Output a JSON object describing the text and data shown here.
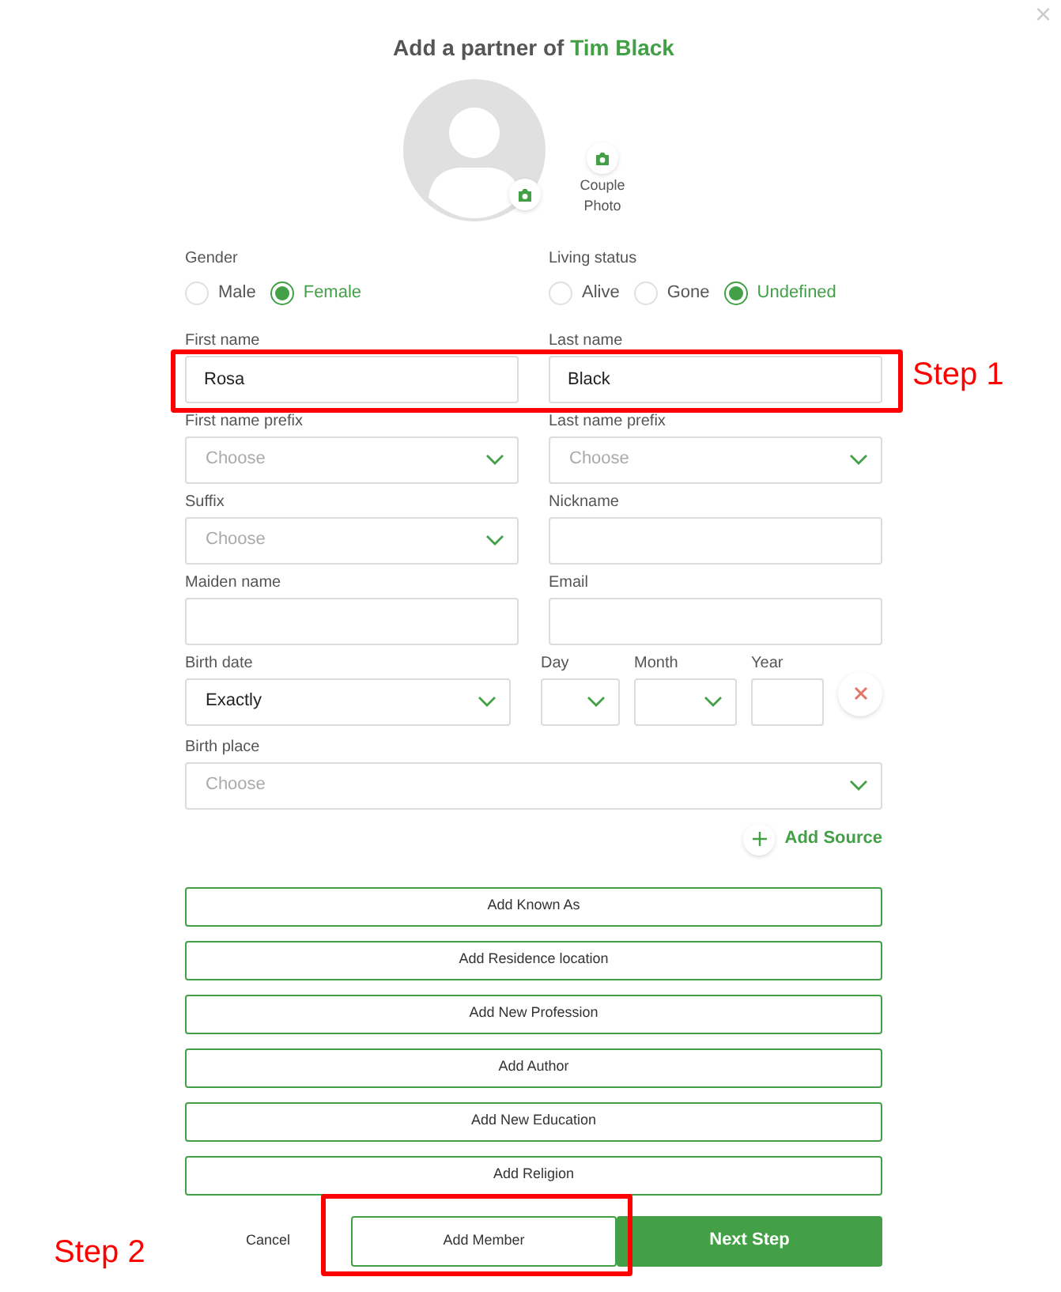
{
  "close": "×",
  "title": {
    "prefix": "Add a partner of",
    "name": "Tim Black"
  },
  "couple_photo": {
    "label": "Couple Photo"
  },
  "gender": {
    "label": "Gender",
    "options": [
      {
        "label": "Male",
        "selected": false
      },
      {
        "label": "Female",
        "selected": true
      }
    ]
  },
  "living_status": {
    "label": "Living status",
    "options": [
      {
        "label": "Alive",
        "selected": false
      },
      {
        "label": "Gone",
        "selected": false
      },
      {
        "label": "Undefined",
        "selected": true
      }
    ]
  },
  "field_rows": [
    [
      {
        "label": "First name",
        "kind": "text",
        "value": "Rosa"
      },
      {
        "label": "Last name",
        "kind": "text",
        "value": "Black"
      }
    ],
    [
      {
        "label": "First name prefix",
        "kind": "select",
        "placeholder": "Choose"
      },
      {
        "label": "Last name prefix",
        "kind": "select",
        "placeholder": "Choose"
      }
    ],
    [
      {
        "label": "Suffix",
        "kind": "select",
        "placeholder": "Choose"
      },
      {
        "label": "Nickname",
        "kind": "text"
      }
    ],
    [
      {
        "label": "Maiden name",
        "kind": "text"
      },
      {
        "label": "Email",
        "kind": "text"
      }
    ]
  ],
  "birth_date": {
    "label": "Birth date",
    "value": "Exactly",
    "day_label": "Day",
    "month_label": "Month",
    "year_label": "Year"
  },
  "birth_place": {
    "label": "Birth place",
    "placeholder": "Choose"
  },
  "add_source": "Add Source",
  "add_buttons": [
    "Add Known As",
    "Add Residence location",
    "Add New Profession",
    "Add Author",
    "Add New Education",
    "Add Religion"
  ],
  "footer": {
    "cancel": "Cancel",
    "add_member": "Add Member",
    "next": "Next Step"
  },
  "annotations": [
    "Step 1",
    "Step 2"
  ]
}
